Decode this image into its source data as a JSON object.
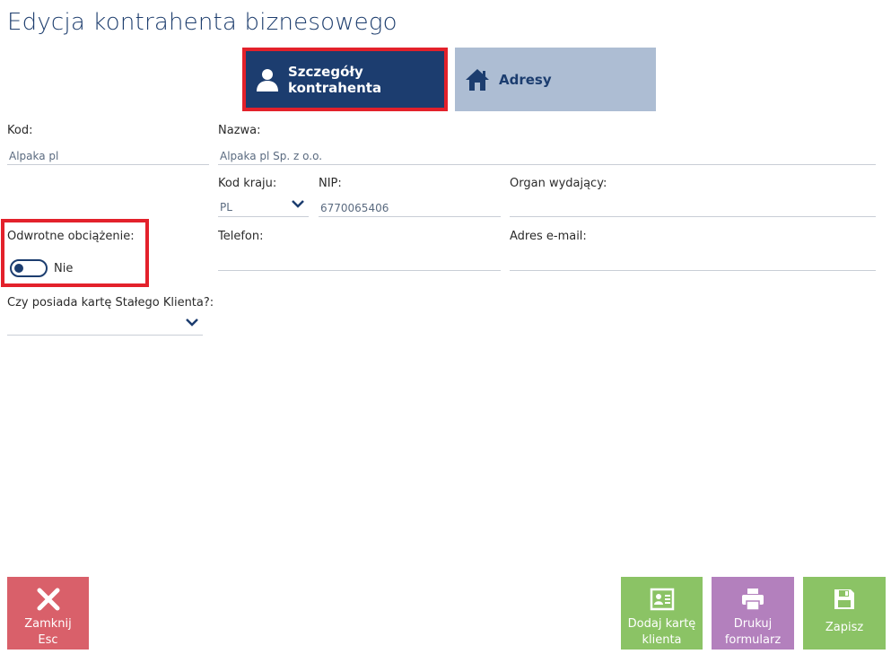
{
  "page": {
    "title": "Edycja kontrahenta biznesowego"
  },
  "tabs": [
    {
      "label": "Szczegóły kontrahenta",
      "icon": "user-icon",
      "active": true
    },
    {
      "label": "Adresy",
      "icon": "home-icon",
      "active": false
    }
  ],
  "form": {
    "kod": {
      "label": "Kod:",
      "value": "Alpaka pl"
    },
    "nazwa": {
      "label": "Nazwa:",
      "value": "Alpaka pl Sp. z o.o."
    },
    "kod_kraju": {
      "label": "Kod kraju:",
      "value": "PL"
    },
    "nip": {
      "label": "NIP:",
      "value": "6770065406"
    },
    "organ": {
      "label": "Organ wydający:",
      "value": ""
    },
    "odwrotne": {
      "label": "Odwrotne obciążenie:",
      "value": "Nie",
      "enabled": false
    },
    "telefon": {
      "label": "Telefon:",
      "value": ""
    },
    "email": {
      "label": "Adres e-mail:",
      "value": ""
    },
    "karta": {
      "label": "Czy posiada kartę Stałego Klienta?:",
      "value": ""
    }
  },
  "buttons": {
    "close": {
      "line1": "Zamknij",
      "line2": "Esc",
      "icon": "close-icon"
    },
    "add_card": {
      "line1": "Dodaj kartę",
      "line2": "klienta",
      "icon": "card-icon"
    },
    "print": {
      "line1": "Drukuj",
      "line2": "formularz",
      "icon": "printer-icon"
    },
    "save": {
      "line1": "Zapisz",
      "icon": "save-icon"
    }
  },
  "colors": {
    "brand_navy": "#1c3d6f",
    "tab_inactive": "#adbdd3",
    "highlight_red": "#e3212b",
    "close_red": "#d9606a",
    "green": "#8bc365",
    "purple": "#b380bd"
  }
}
